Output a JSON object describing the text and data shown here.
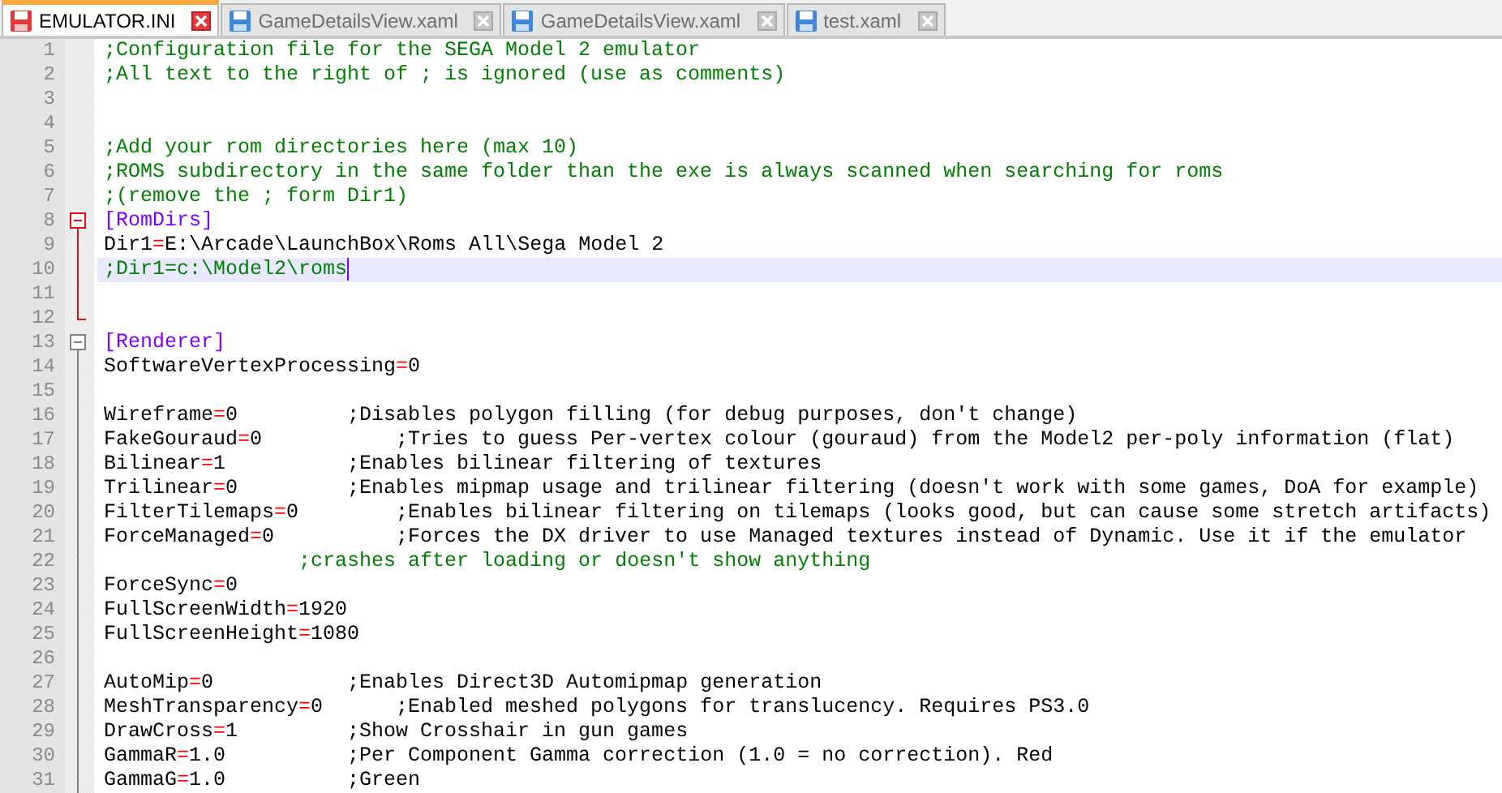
{
  "tabs": [
    {
      "label": "EMULATOR.INI",
      "selected": true,
      "modified": true
    },
    {
      "label": "GameDetailsView.xaml",
      "selected": false,
      "modified": false
    },
    {
      "label": "GameDetailsView.xaml",
      "selected": false,
      "modified": false
    },
    {
      "label": "test.xaml",
      "selected": false,
      "modified": false
    }
  ],
  "lines": [
    {
      "number": "1",
      "current": false,
      "segments": [
        {
          "kind": "comment",
          "text": ";Configuration file for the SEGA Model 2 emulator"
        }
      ]
    },
    {
      "number": "2",
      "current": false,
      "segments": [
        {
          "kind": "comment",
          "text": ";All text to the right of ; is ignored (use as comments)"
        }
      ]
    },
    {
      "number": "3",
      "current": false
    },
    {
      "number": "4",
      "current": false
    },
    {
      "number": "5",
      "current": false,
      "segments": [
        {
          "kind": "comment",
          "text": ";Add your rom directories here (max 10)"
        }
      ]
    },
    {
      "number": "6",
      "current": false,
      "segments": [
        {
          "kind": "comment",
          "text": ";ROMS subdirectory in the same folder than the exe is always scanned when searching for roms"
        }
      ]
    },
    {
      "number": "7",
      "current": false,
      "segments": [
        {
          "kind": "comment",
          "text": ";(remove the ; form Dir1)"
        }
      ]
    },
    {
      "number": "8",
      "current": false,
      "expanded": true,
      "segments": [
        {
          "kind": "section",
          "text": "[RomDirs]"
        }
      ]
    },
    {
      "number": "9",
      "current": false,
      "segments": [
        {
          "kind": "key",
          "text": "Dir1"
        },
        {
          "kind": "operator",
          "text": "="
        },
        {
          "kind": "value",
          "text": "E:\\Arcade\\LaunchBox\\Roms All\\Sega Model 2"
        }
      ]
    },
    {
      "number": "10",
      "current": true,
      "segments": [
        {
          "kind": "comment",
          "text": ";Dir1=c:\\Model2\\roms"
        }
      ]
    },
    {
      "number": "11",
      "current": false
    },
    {
      "number": "12",
      "current": false
    },
    {
      "number": "13",
      "current": false,
      "expanded": true,
      "segments": [
        {
          "kind": "section",
          "text": "[Renderer]"
        }
      ]
    },
    {
      "number": "14",
      "current": false,
      "segments": [
        {
          "kind": "key",
          "text": "SoftwareVertexProcessing"
        },
        {
          "kind": "operator",
          "text": "="
        },
        {
          "kind": "value",
          "text": "0"
        }
      ]
    },
    {
      "number": "15",
      "current": false
    },
    {
      "number": "16",
      "current": false,
      "segments": [
        {
          "kind": "key",
          "text": "Wireframe"
        },
        {
          "kind": "operator",
          "text": "="
        },
        {
          "kind": "value",
          "text": "0\t\t\t;Disables polygon filling (for debug purposes, don't change)"
        }
      ]
    },
    {
      "number": "17",
      "current": false,
      "segments": [
        {
          "kind": "key",
          "text": "FakeGouraud"
        },
        {
          "kind": "operator",
          "text": "="
        },
        {
          "kind": "value",
          "text": "0\t\t\t;Tries to guess Per-vertex colour (gouraud) from the Model2 per-poly information (flat)"
        }
      ]
    },
    {
      "number": "18",
      "current": false,
      "segments": [
        {
          "kind": "key",
          "text": "Bilinear"
        },
        {
          "kind": "operator",
          "text": "="
        },
        {
          "kind": "value",
          "text": "1\t\t\t;Enables bilinear filtering of textures"
        }
      ]
    },
    {
      "number": "19",
      "current": false,
      "segments": [
        {
          "kind": "key",
          "text": "Trilinear"
        },
        {
          "kind": "operator",
          "text": "="
        },
        {
          "kind": "value",
          "text": "0\t\t\t;Enables mipmap usage and trilinear filtering (doesn't work with some games, DoA for example)"
        }
      ]
    },
    {
      "number": "20",
      "current": false,
      "segments": [
        {
          "kind": "key",
          "text": "FilterTilemaps"
        },
        {
          "kind": "operator",
          "text": "="
        },
        {
          "kind": "value",
          "text": "0\t\t;Enables bilinear filtering on tilemaps (looks good, but can cause some stretch artifacts)"
        }
      ]
    },
    {
      "number": "21",
      "current": false,
      "segments": [
        {
          "kind": "key",
          "text": "ForceManaged"
        },
        {
          "kind": "operator",
          "text": "="
        },
        {
          "kind": "value",
          "text": "0\t\t\t;Forces the DX driver to use Managed textures instead of Dynamic. Use it if the emulator"
        }
      ]
    },
    {
      "number": "22",
      "current": false,
      "segments": [
        {
          "kind": "comment",
          "text": "\t\t\t\t;crashes after loading or doesn't show anything"
        }
      ]
    },
    {
      "number": "23",
      "current": false,
      "segments": [
        {
          "kind": "key",
          "text": "ForceSync"
        },
        {
          "kind": "operator",
          "text": "="
        },
        {
          "kind": "value",
          "text": "0"
        }
      ]
    },
    {
      "number": "24",
      "current": false,
      "segments": [
        {
          "kind": "key",
          "text": "FullScreenWidth"
        },
        {
          "kind": "operator",
          "text": "="
        },
        {
          "kind": "value",
          "text": "1920"
        }
      ]
    },
    {
      "number": "25",
      "current": false,
      "segments": [
        {
          "kind": "key",
          "text": "FullScreenHeight"
        },
        {
          "kind": "operator",
          "text": "="
        },
        {
          "kind": "value",
          "text": "1080"
        }
      ]
    },
    {
      "number": "26",
      "current": false
    },
    {
      "number": "27",
      "current": false,
      "segments": [
        {
          "kind": "key",
          "text": "AutoMip"
        },
        {
          "kind": "operator",
          "text": "="
        },
        {
          "kind": "value",
          "text": "0\t\t\t;Enables Direct3D Automipmap generation"
        }
      ]
    },
    {
      "number": "28",
      "current": false,
      "segments": [
        {
          "kind": "key",
          "text": "MeshTransparency"
        },
        {
          "kind": "operator",
          "text": "="
        },
        {
          "kind": "value",
          "text": "0\t\t;Enabled meshed polygons for translucency. Requires PS3.0"
        }
      ]
    },
    {
      "number": "29",
      "current": false,
      "segments": [
        {
          "kind": "key",
          "text": "DrawCross"
        },
        {
          "kind": "operator",
          "text": "="
        },
        {
          "kind": "value",
          "text": "1\t\t\t;Show Crosshair in gun games"
        }
      ]
    },
    {
      "number": "30",
      "current": false,
      "segments": [
        {
          "kind": "key",
          "text": "GammaR"
        },
        {
          "kind": "operator",
          "text": "="
        },
        {
          "kind": "value",
          "text": "1.0\t\t\t;Per Component Gamma correction (1.0 = no correction). Red"
        }
      ]
    },
    {
      "number": "31",
      "current": false,
      "segments": [
        {
          "kind": "key",
          "text": "GammaG"
        },
        {
          "kind": "operator",
          "text": "="
        },
        {
          "kind": "value",
          "text": "1.0\t\t\t;Green"
        }
      ]
    }
  ]
}
